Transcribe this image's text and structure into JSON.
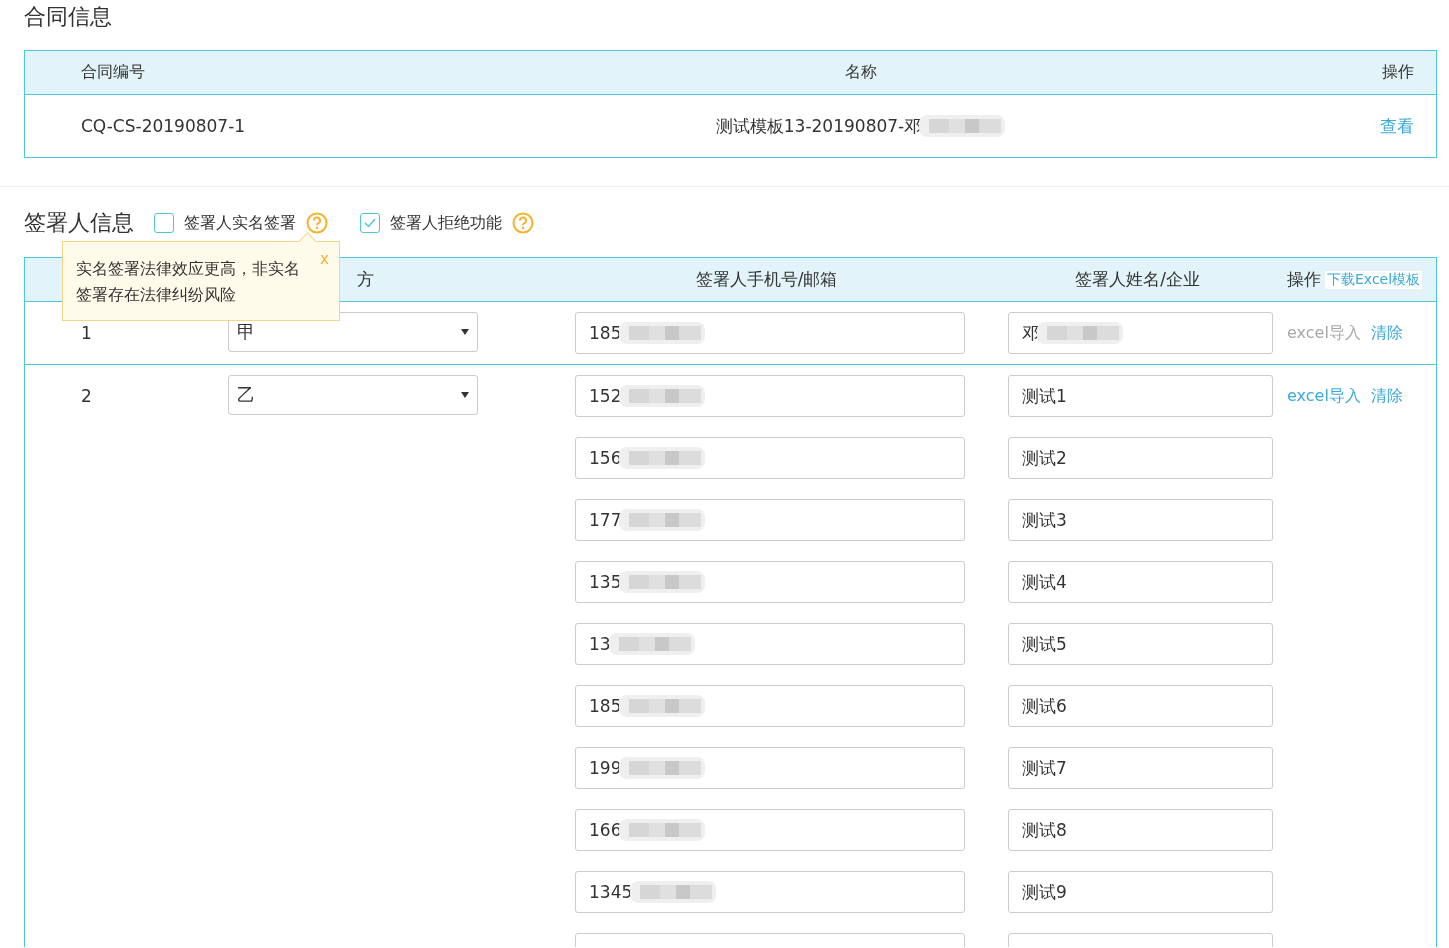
{
  "contract": {
    "title": "合同信息",
    "columns": [
      "合同编号",
      "名称",
      "操作"
    ],
    "rows": [
      {
        "number": "CQ-CS-20190807-1",
        "name": "测试模板13-20190807-邓",
        "redacted": true,
        "action": "查看"
      }
    ]
  },
  "signers": {
    "title": "签署人信息",
    "options": [
      {
        "label": "签署人实名签署",
        "checked": false
      },
      {
        "label": "签署人拒绝功能",
        "checked": true
      }
    ],
    "tooltip": {
      "text": "实名签署法律效应更高，非实名签署存在法律纠纷风险",
      "close": "x"
    },
    "columns": [
      "方",
      "签署人手机号/邮箱",
      "签署人姓名/企业",
      "操作"
    ],
    "download_link": "下载Excel模板",
    "rows": [
      {
        "index": "1",
        "party": "甲",
        "import": {
          "label": "excel导入",
          "disabled": true
        },
        "clear": "清除",
        "entries": [
          {
            "kind": "entry",
            "phone": "185",
            "phone_redacted": true,
            "name": "邓",
            "name_redacted": true
          }
        ]
      },
      {
        "index": "2",
        "party": "乙",
        "import": {
          "label": "excel导入",
          "disabled": false
        },
        "clear": "清除",
        "entries": [
          {
            "kind": "entry",
            "phone": "152",
            "phone_redacted": true,
            "name": "测试1",
            "name_redacted": false
          },
          {
            "kind": "entry",
            "phone": "156",
            "phone_redacted": true,
            "name": "测试2",
            "name_redacted": false
          },
          {
            "kind": "entry",
            "phone": "177",
            "phone_redacted": true,
            "name": "测试3",
            "name_redacted": false
          },
          {
            "kind": "entry",
            "phone": "135",
            "phone_redacted": true,
            "name": "测试4",
            "name_redacted": false
          },
          {
            "kind": "entry",
            "phone": "13",
            "phone_redacted": true,
            "name": "测试5",
            "name_redacted": false
          },
          {
            "kind": "entry",
            "phone": "185",
            "phone_redacted": true,
            "name": "测试6",
            "name_redacted": false
          },
          {
            "kind": "entry",
            "phone": "199",
            "phone_redacted": true,
            "name": "测试7",
            "name_redacted": false
          },
          {
            "kind": "entry",
            "phone": "166",
            "phone_redacted": true,
            "name": "测试8",
            "name_redacted": false
          },
          {
            "kind": "entry",
            "phone": "1345",
            "phone_redacted": true,
            "name": "测试9",
            "name_redacted": false
          },
          {
            "kind": "cut"
          }
        ]
      }
    ]
  }
}
